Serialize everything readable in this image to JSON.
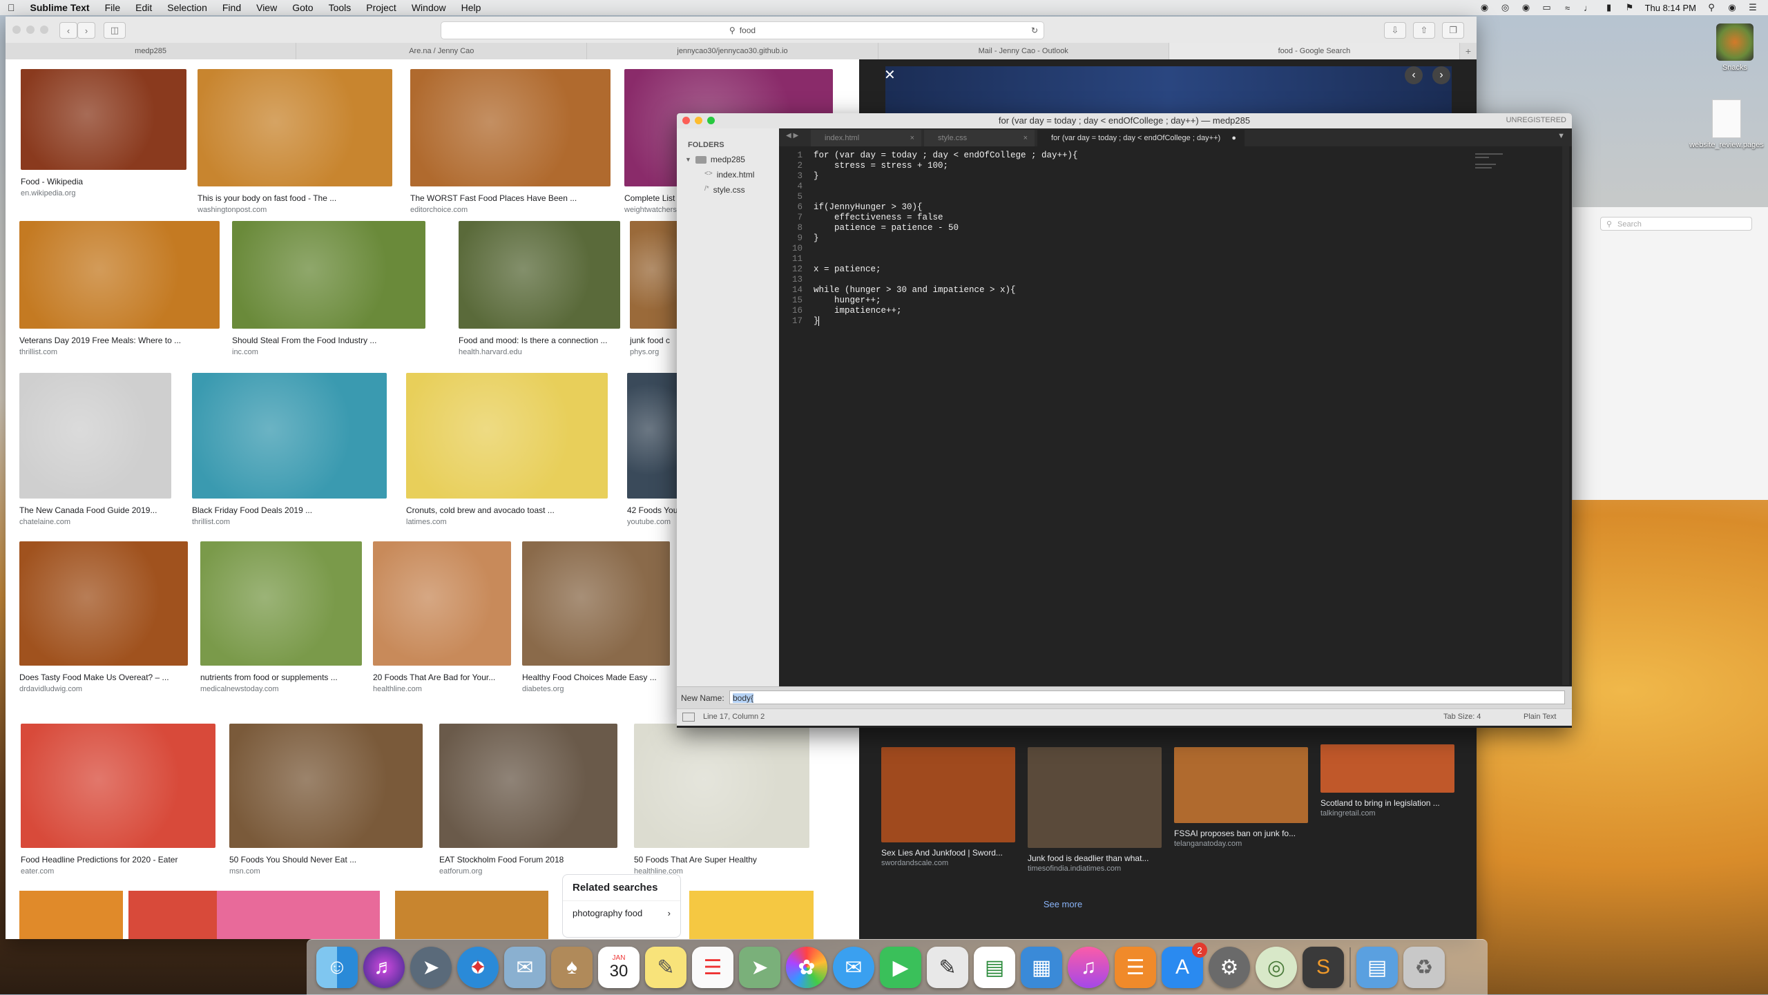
{
  "menubar": {
    "app": "Sublime Text",
    "items": [
      "File",
      "Edit",
      "Selection",
      "Find",
      "View",
      "Goto",
      "Tools",
      "Project",
      "Window",
      "Help"
    ],
    "clock": "Thu 8:14 PM"
  },
  "safari": {
    "url": "food",
    "tabs": [
      "medp285",
      "Are.na / Jenny Cao",
      "jennycao30/jennycao30.github.io",
      "Mail - Jenny Cao - Outlook",
      "food - Google Search"
    ],
    "results": [
      {
        "title": "Food - Wikipedia",
        "source": "en.wikipedia.org",
        "color": "#8a3a1e"
      },
      {
        "title": "This is your body on fast food - The ...",
        "source": "washingtonpost.com",
        "color": "#c8852f"
      },
      {
        "title": "The WORST Fast Food Places Have Been ...",
        "source": "editorchoice.com",
        "color": "#b06a2e"
      },
      {
        "title": "Complete List",
        "source": "weightwatchers",
        "color": "#8a2b6a"
      },
      {
        "title": "Veterans Day 2019 Free Meals: Where to ...",
        "source": "thrillist.com",
        "color": "#c47a22"
      },
      {
        "title": "Should Steal From the Food Industry ...",
        "source": "inc.com",
        "color": "#6a8a3a"
      },
      {
        "title": "Food and mood: Is there a connection ...",
        "source": "health.harvard.edu",
        "color": "#5a6a3a"
      },
      {
        "title": "junk food c",
        "source": "phys.org",
        "color": "#9a6a3a"
      },
      {
        "title": "The New Canada Food Guide 2019...",
        "source": "chatelaine.com",
        "color": "#cfcfcf"
      },
      {
        "title": "Black Friday Food Deals 2019 ...",
        "source": "thrillist.com",
        "color": "#3a9ab0"
      },
      {
        "title": "Cronuts, cold brew and avocado toast ...",
        "source": "latimes.com",
        "color": "#e8cf5a"
      },
      {
        "title": "42 Foods You",
        "source": "youtube.com",
        "color": "#3a4a5a"
      },
      {
        "title": "Does Tasty Food Make Us Overeat? – ...",
        "source": "drdavidludwig.com",
        "color": "#a0521e"
      },
      {
        "title": "nutrients from food or supplements ...",
        "source": "medicalnewstoday.com",
        "color": "#7a9a4a"
      },
      {
        "title": "20 Foods That Are Bad for Your...",
        "source": "healthline.com",
        "color": "#c88a5a"
      },
      {
        "title": "Healthy Food Choices Made Easy ...",
        "source": "diabetes.org",
        "color": "#8a6a4a"
      },
      {
        "title": "Food Headline Predictions for 2020 - Eater",
        "source": "eater.com",
        "color": "#d84a3a"
      },
      {
        "title": "50 Foods You Should Never Eat ...",
        "source": "msn.com",
        "color": "#7a5a3a"
      },
      {
        "title": "EAT Stockholm Food Forum 2018",
        "source": "eatforum.org",
        "color": "#6a5a4a"
      },
      {
        "title": "50 Foods That Are Super Healthy",
        "source": "healthline.com",
        "color": "#dcdcd0"
      }
    ],
    "related": {
      "heading": "Related searches",
      "item": "photography food"
    },
    "viewer_results": [
      {
        "title": "Sex Lies And Junkfood | Sword...",
        "source": "swordandscale.com"
      },
      {
        "title": "Junk food is deadlier than what...",
        "source": "timesofindia.indiatimes.com"
      },
      {
        "title": "FSSAI proposes ban on junk fo...",
        "source": "telanganatoday.com"
      },
      {
        "title": "Scotland to bring in legislation ...",
        "source": "talkingretail.com"
      }
    ],
    "see_more": "See more"
  },
  "sublime": {
    "title": "for (var day = today ; day < endOfCollege ; day++) — medp285",
    "unregistered": "UNREGISTERED",
    "folders_heading": "FOLDERS",
    "project": "medp285",
    "files": [
      "index.html",
      "style.css"
    ],
    "tabs": [
      "index.html",
      "style.css",
      "for (var day = today ; day < endOfCollege ; day++)"
    ],
    "code": [
      "for (var day = today ; day < endOfCollege ; day++){",
      "    stress = stress + 100;",
      "}",
      "",
      "",
      "if(JennyHunger > 30){",
      "    effectiveness = false",
      "    patience = patience - 50",
      "}",
      "",
      "",
      "x = patience;",
      "",
      "while (hunger > 30 and impatience > x){",
      "    hunger++;",
      "    impatience++;",
      "}"
    ],
    "name_label": "New Name:",
    "name_value": "body{",
    "status_position": "Line 17, Column 2",
    "tab_size": "Tab Size: 4",
    "syntax": "Plain Text"
  },
  "desktop": {
    "icons": [
      "Snacks",
      "website_review.pages"
    ]
  },
  "finder": {
    "search_placeholder": "Search"
  },
  "dock": {
    "appstore_badge": "2",
    "calendar_day": "30",
    "calendar_month": "JAN"
  }
}
